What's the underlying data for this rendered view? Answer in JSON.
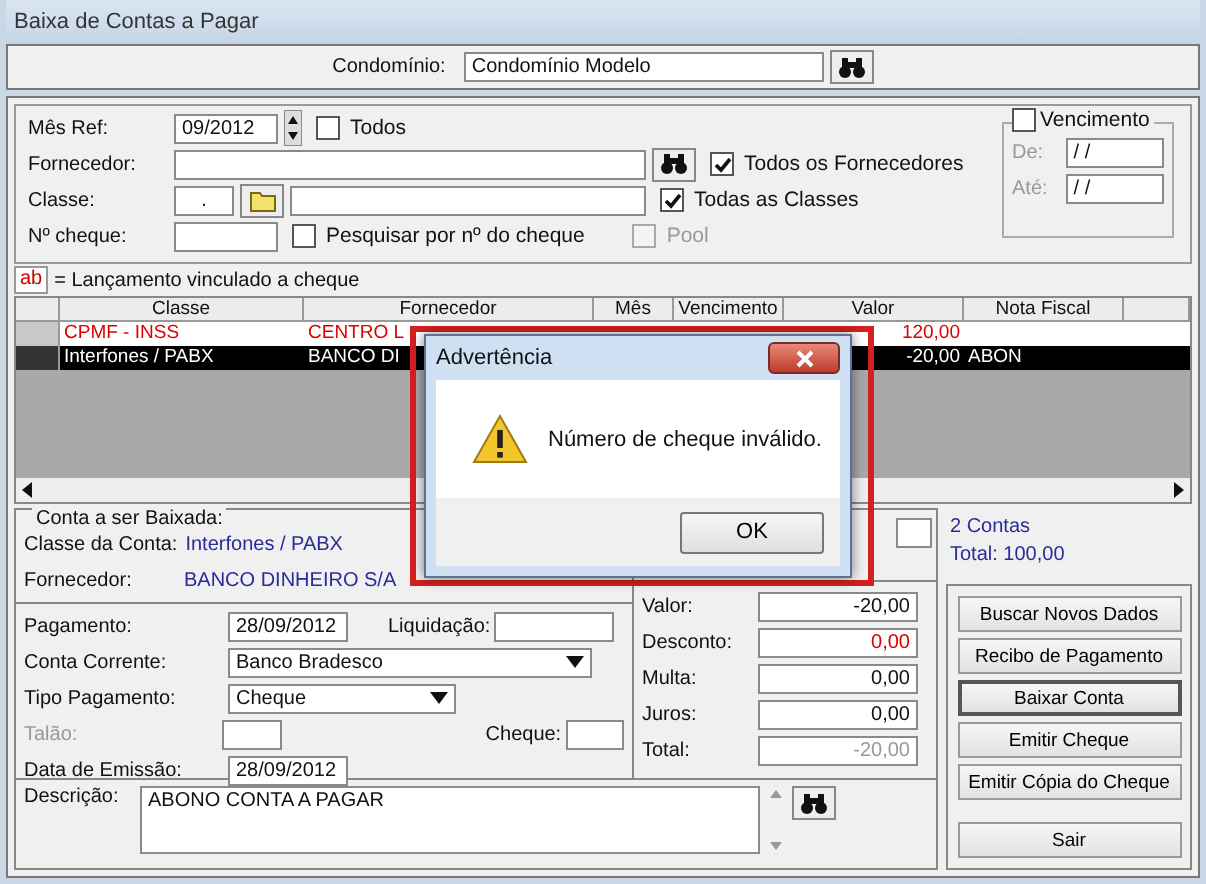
{
  "window": {
    "title": "Baixa de Contas a Pagar"
  },
  "condominio": {
    "label": "Condomínio:",
    "value": "Condomínio Modelo"
  },
  "filters": {
    "mes_ref": {
      "label": "Mês Ref:",
      "value": "09/2012"
    },
    "todos": {
      "label": "Todos",
      "checked": false
    },
    "fornecedor": {
      "label": "Fornecedor:"
    },
    "todos_fornecedores": {
      "label": "Todos os Fornecedores",
      "checked": true
    },
    "classe": {
      "label": "Classe:",
      "code": "."
    },
    "todas_classes": {
      "label": "Todas as Classes",
      "checked": true
    },
    "cheque": {
      "label": "Nº cheque:"
    },
    "pesquisar": {
      "label": "Pesquisar por nº do cheque",
      "checked": false
    },
    "pool": {
      "label": "Pool",
      "checked": false,
      "disabled": true
    },
    "vencimento": {
      "label": "Vencimento",
      "checked": false,
      "de_label": "De:",
      "de_value": "/ /",
      "ate_label": "Até:",
      "ate_value": "/ /"
    }
  },
  "legend": {
    "badge": "ab",
    "text": "= Lançamento vinculado a cheque"
  },
  "table": {
    "columns": [
      "Classe",
      "Fornecedor",
      "Mês",
      "Vencimento",
      "Valor",
      "Nota Fiscal"
    ],
    "rows": [
      {
        "classe": "CPMF - INSS",
        "fornecedor": "CENTRO L",
        "valor": "120,00",
        "linked": true,
        "selected": false
      },
      {
        "classe": "Interfones / PABX",
        "fornecedor": "BANCO DI",
        "valor": "-20,00",
        "nota_fiscal": "ABON",
        "linked": false,
        "selected": true
      }
    ]
  },
  "conta": {
    "title": "Conta a ser Baixada:",
    "classe_label": "Classe da Conta:",
    "classe": "Interfones / PABX",
    "fornecedor_label": "Fornecedor:",
    "fornecedor": "BANCO DINHEIRO S/A",
    "pagamento_label": "Pagamento:",
    "pagamento": "28/09/2012",
    "liquidacao_label": "Liquidação:",
    "conta_corrente_label": "Conta Corrente:",
    "conta_corrente": "Banco Bradesco",
    "tipo_label": "Tipo Pagamento:",
    "tipo": "Cheque",
    "talao_label": "Talão:",
    "talao_disabled": true,
    "cheque_label": "Cheque:",
    "emissao_label": "Data de Emissão:",
    "emissao": "28/09/2012",
    "descricao_label": "Descrição:",
    "descricao": "ABONO CONTA A PAGAR"
  },
  "valores": [
    {
      "label": "Valor:",
      "value": "-20,00",
      "kind": "normal"
    },
    {
      "label": "Desconto:",
      "value": "0,00",
      "kind": "discount"
    },
    {
      "label": "Multa:",
      "value": "0,00",
      "kind": "normal"
    },
    {
      "label": "Juros:",
      "value": "0,00",
      "kind": "normal"
    },
    {
      "label": "Total:",
      "value": "-20,00",
      "kind": "readonly"
    }
  ],
  "summary": {
    "count": "2 Contas",
    "total": "Total: 100,00"
  },
  "buttons": [
    {
      "label": "Buscar Novos Dados",
      "default": false
    },
    {
      "label": "Recibo de Pagamento",
      "default": false
    },
    {
      "label": "Baixar Conta",
      "default": true
    },
    {
      "label": "Emitir Cheque",
      "default": false
    },
    {
      "label": "Emitir Cópia do Cheque",
      "default": false
    },
    {
      "label": "Sair",
      "default": false
    }
  ],
  "dialog": {
    "title": "Advertência",
    "message": "Número de cheque inválido.",
    "button": "OK"
  }
}
